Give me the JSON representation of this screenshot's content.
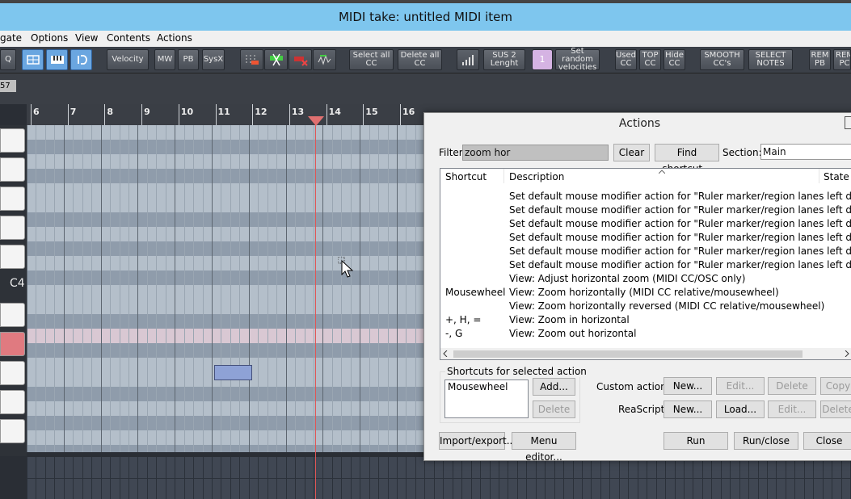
{
  "window": {
    "title": "MIDI take: untitled MIDI item"
  },
  "menu": [
    "gate",
    "Options",
    "View",
    "Contents",
    "Actions"
  ],
  "toolbar": {
    "q": "Q",
    "velocity": "Velocity",
    "mw": "MW",
    "pb": "PB",
    "sysx": "SysX",
    "select_all_cc": "Select all CC",
    "delete_all_cc": "Delete all CC",
    "sus2": "SUS 2 Lenght",
    "num": "1",
    "set_random": "Set random velocities",
    "used_cc": "Used CC",
    "top_cc": "TOP CC",
    "hide_cc": "Hide CC",
    "smooth": "SMOOTH CC's",
    "select_notes": "SELECT NOTES",
    "rem_pb": "REM PB",
    "rem_pc": "REM PC"
  },
  "ruler": {
    "offset": "57",
    "numbers": [
      "6",
      "7",
      "8",
      "9",
      "10",
      "11",
      "12",
      "13",
      "14",
      "15",
      "16"
    ]
  },
  "piano": {
    "c4_label": "C4"
  },
  "colors": {
    "title_bg": "#7ec6ee",
    "toolbar_bg": "#3b4048",
    "playhead": "#e05555",
    "note": "#8ea2d6"
  },
  "actions": {
    "title": "Actions",
    "filter_label": "Filter:",
    "filter_value": "zoom hor",
    "clear": "Clear",
    "find_shortcut": "Find shortcut...",
    "section_label": "Section:",
    "section_value": "Main",
    "columns": {
      "shortcut": "Shortcut",
      "description": "Description",
      "state": "State"
    },
    "rows": [
      {
        "shortcut": "",
        "description": "Set default mouse modifier action for \"Ruler marker/region lanes left drag\" to \"..."
      },
      {
        "shortcut": "",
        "description": "Set default mouse modifier action for \"Ruler marker/region lanes left drag\" to \"..."
      },
      {
        "shortcut": "",
        "description": "Set default mouse modifier action for \"Ruler marker/region lanes left drag\" to \"..."
      },
      {
        "shortcut": "",
        "description": "Set default mouse modifier action for \"Ruler marker/region lanes left drag\" to \"..."
      },
      {
        "shortcut": "",
        "description": "Set default mouse modifier action for \"Ruler marker/region lanes left drag\" to \"..."
      },
      {
        "shortcut": "",
        "description": "Set default mouse modifier action for \"Ruler marker/region lanes left drag\" to \"..."
      },
      {
        "shortcut": "",
        "description": "View: Adjust horizontal zoom (MIDI CC/OSC only)"
      },
      {
        "shortcut": "Mousewheel",
        "description": "View: Zoom horizontally (MIDI CC relative/mousewheel)"
      },
      {
        "shortcut": "",
        "description": "View: Zoom horizontally reversed (MIDI CC relative/mousewheel)"
      },
      {
        "shortcut": "+, H, =",
        "description": "View: Zoom in horizontal"
      },
      {
        "shortcut": "-, G",
        "description": "View: Zoom out horizontal"
      }
    ],
    "shortcuts_group": "Shortcuts for selected action",
    "selected_shortcut": "Mousewheel",
    "add": "Add...",
    "delete": "Delete",
    "custom_actions_label": "Custom actions:",
    "custom_new": "New...",
    "custom_edit": "Edit...",
    "custom_delete": "Delete",
    "custom_copy": "Copy",
    "reascript_label": "ReaScript:",
    "rs_new": "New...",
    "rs_load": "Load...",
    "rs_edit": "Edit...",
    "rs_delete": "Delete",
    "import_export": "Import/export...",
    "menu_editor": "Menu editor...",
    "run": "Run",
    "run_close": "Run/close",
    "close": "Close"
  }
}
